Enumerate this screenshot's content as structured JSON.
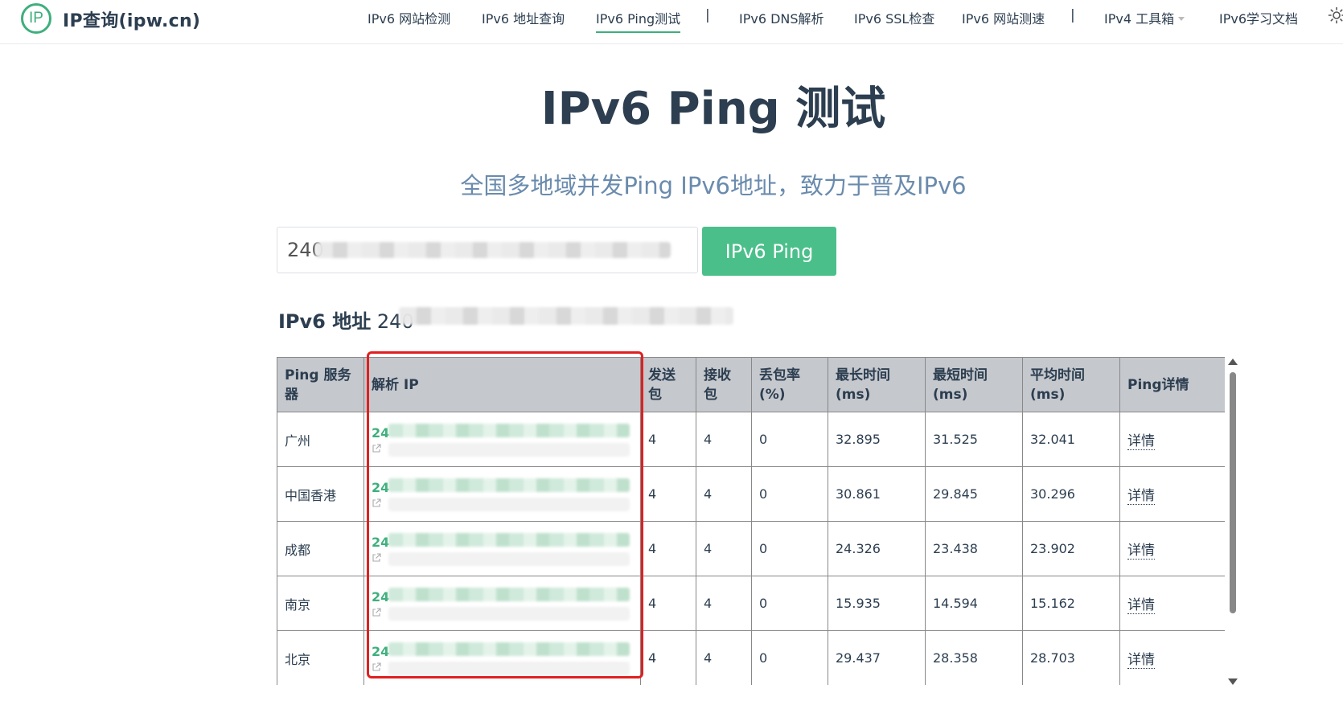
{
  "header": {
    "logo_mark": "IP",
    "logo_text": "IP查询(ipw.cn)",
    "nav": [
      {
        "label": "IPv6 网站检测"
      },
      {
        "label": "IPv6 地址查询"
      },
      {
        "label": "IPv6 Ping测试"
      },
      {
        "label": "IPv6 DNS解析"
      },
      {
        "label": "IPv6 SSL检查"
      },
      {
        "label": "IPv6 网站测速"
      },
      {
        "label": "IPv4 工具箱"
      },
      {
        "label": "IPv6学习文档"
      }
    ],
    "separator": "|",
    "accent_color": "#3eaf7c"
  },
  "hero": {
    "title": "IPv6 Ping 测试",
    "subtitle": "全国多地域并发Ping IPv6地址，致力于普及IPv6"
  },
  "form": {
    "input_value": "240",
    "button_label": "IPv6 Ping"
  },
  "address": {
    "label": "IPv6 地址",
    "value": "240"
  },
  "table": {
    "headers": {
      "server": "Ping 服务器",
      "ip": "解析 IP",
      "sent": "发送包",
      "received": "接收包",
      "loss": "丢包率(%)",
      "max": "最长时间(ms)",
      "min": "最短时间(ms)",
      "avg": "平均时间(ms)",
      "detail": "Ping详情"
    },
    "rows": [
      {
        "server": "广州",
        "ip": "24",
        "sent": "4",
        "received": "4",
        "loss": "0",
        "max": "32.895",
        "min": "31.525",
        "avg": "32.041",
        "detail": "详情"
      },
      {
        "server": "中国香港",
        "ip": "24",
        "sent": "4",
        "received": "4",
        "loss": "0",
        "max": "30.861",
        "min": "29.845",
        "avg": "30.296",
        "detail": "详情"
      },
      {
        "server": "成都",
        "ip": "24",
        "sent": "4",
        "received": "4",
        "loss": "0",
        "max": "24.326",
        "min": "23.438",
        "avg": "23.902",
        "detail": "详情"
      },
      {
        "server": "南京",
        "ip": "24",
        "sent": "4",
        "received": "4",
        "loss": "0",
        "max": "15.935",
        "min": "14.594",
        "avg": "15.162",
        "detail": "详情"
      },
      {
        "server": "北京",
        "ip": "24",
        "sent": "4",
        "received": "4",
        "loss": "0",
        "max": "29.437",
        "min": "28.358",
        "avg": "28.703",
        "detail": "详情"
      }
    ]
  },
  "colors": {
    "button_bg": "#4abf8a",
    "highlight_box": "#e02020",
    "header_bg": "#c5c8cd"
  }
}
